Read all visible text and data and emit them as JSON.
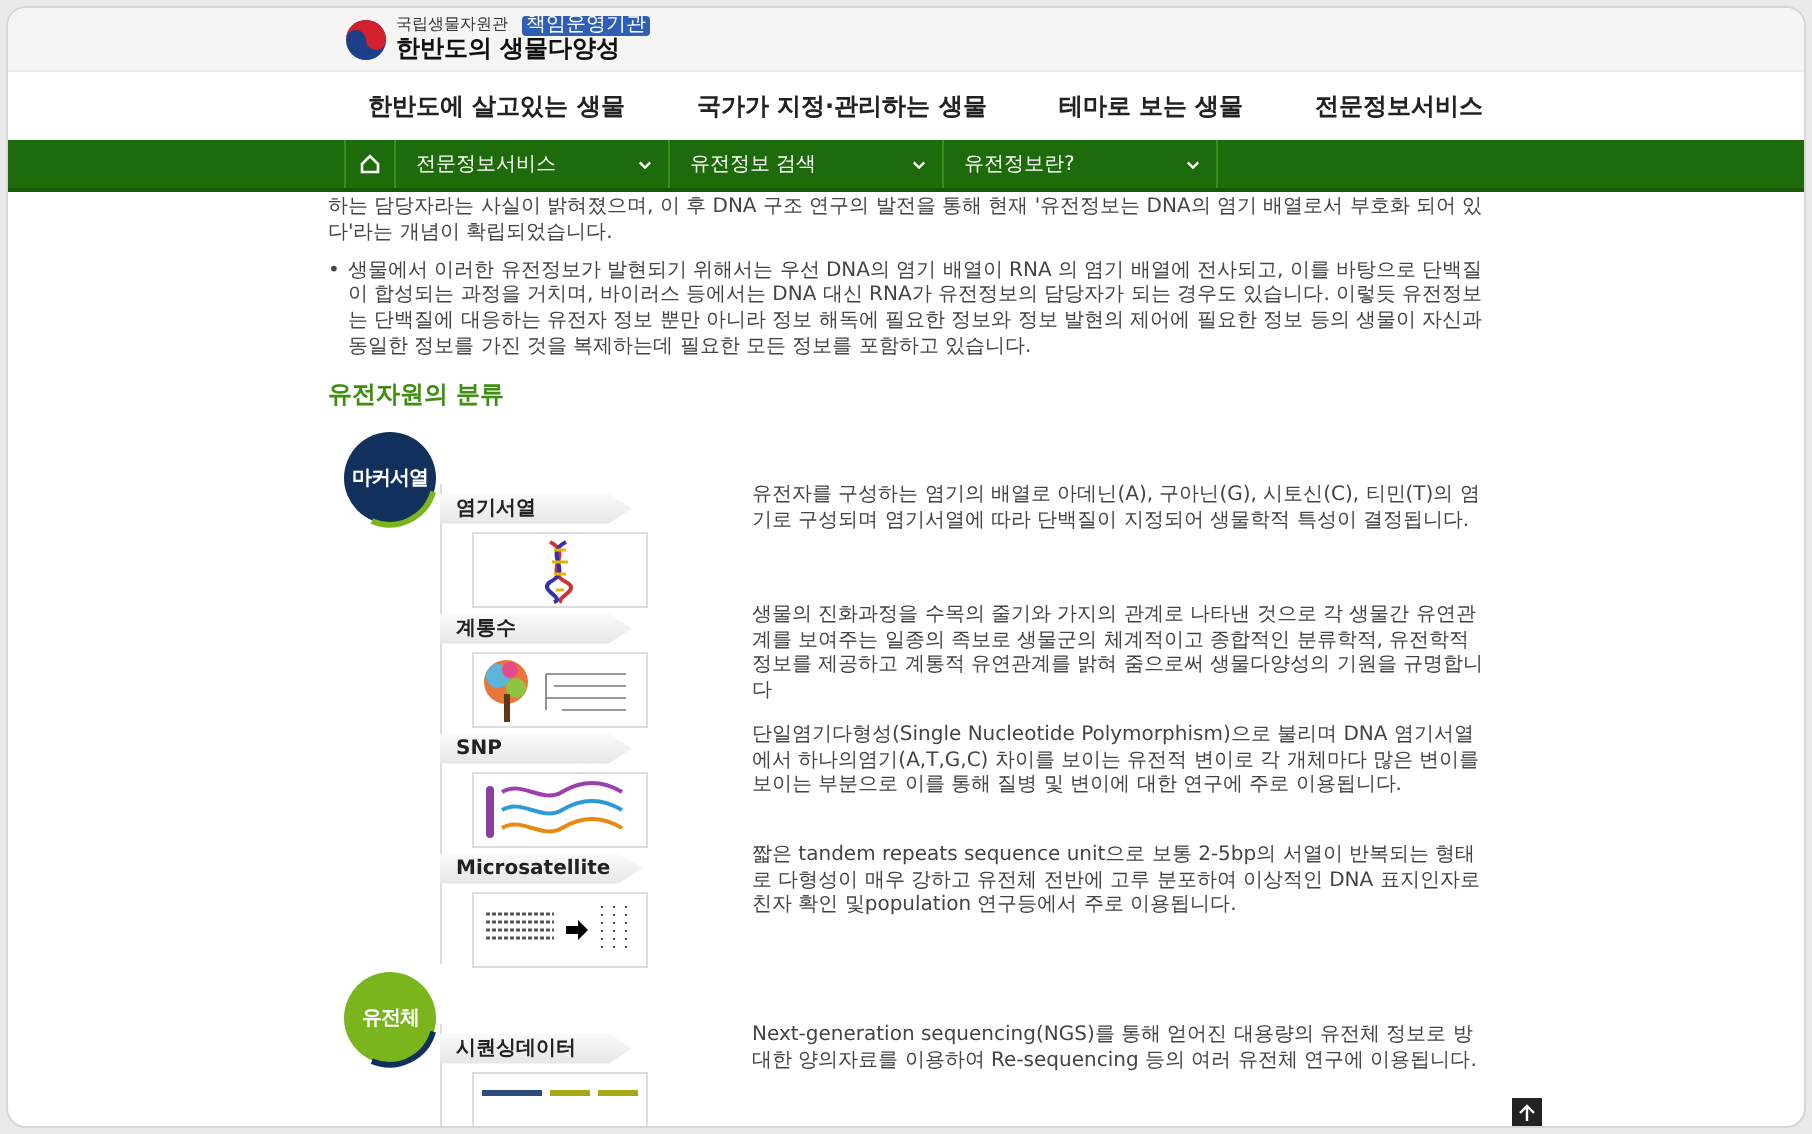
{
  "site": {
    "agency": "국립생물자원관",
    "badge": "책임운영기관",
    "title": "한반도의 생물다양성"
  },
  "nav": [
    "한반도에 살고있는 생물",
    "국가가 지정·관리하는 생물",
    "테마로 보는 생물",
    "전문정보서비스"
  ],
  "breadcrumb": [
    "전문정보서비스",
    "유전정보 검색",
    "유전정보란?"
  ],
  "intro": {
    "text": "하는 담당자라는 사실이 밝혀졌으며, 이 후 DNA 구조 연구의 발전을 통해 현재 '유전정보는 DNA의 염기 배열로서 부호화 되어 있다'라는 개념이 확립되었습니다.",
    "bullets": [
      {
        "marker": "•",
        "text": "생물에서 이러한 유전정보가 발현되기 위해서는 우선 DNA의 염기 배열이 RNA 의 염기 배열에 전사되고, 이를 바탕으로 단백질이 합성되는 과정을 거치며, 바이러스 등에서는 DNA 대신 RNA가 유전정보의 담당자가 되는 경우도 있습니다. 이렇듯 유전정보는 단백질에 대응하는 유전자 정보 뿐만 아니라 정보 해독에 필요한 정보와 정보 발현의 제어에 필요한 정보 등의 생물이 자신과 동일한 정보를 가진 것을 복제하는데 필요한 모든 정보를 포함하고 있습니다."
      }
    ]
  },
  "section_title": "유전자원의 분류",
  "categories": [
    {
      "label": "마커서열",
      "color": "#12305c",
      "items": [
        {
          "label": "염기서열",
          "kind": "dna",
          "description": "유전자를 구성하는 염기의 배열로 아데닌(A), 구아닌(G), 시토신(C), 티민(T)의 염기로 구성되며 염기서열에 따라 단백질이 지정되어 생물학적 특성이 결정됩니다."
        },
        {
          "label": "계통수",
          "kind": "tree",
          "description": "생물의 진화과정을 수목의 줄기와 가지의 관계로 나타낸 것으로 각 생물간 유연관계를 보여주는 일종의 족보로 생물군의 체계적이고 종합적인 분류학적, 유전학적 정보를 제공하고 계통적 유연관계를 밝혀 줌으로써 생물다양성의 기원을 규명합니다"
        },
        {
          "label": "SNP",
          "kind": "snp",
          "description": "단일염기다형성(Single Nucleotide Polymorphism)으로 불리며 DNA 염기서열에서 하나의염기(A,T,G,C) 차이를 보이는 유전적 변이로 각 개체마다 많은 변이를 보이는 부분으로 이를 통해 질병 및 변이에 대한 연구에 주로 이용됩니다."
        },
        {
          "label": "Microsatellite",
          "kind": "repeats",
          "description": "짧은 tandem repeats sequence unit으로 보통 2-5bp의 서열이 반복되는 형태로 다형성이 매우 강하고 유전체 전반에 고루 분포하여 이상적인 DNA 표지인자로 친자 확인 및population 연구등에서 주로 이용됩니다."
        }
      ]
    },
    {
      "label": "유전체",
      "color": "#7ab51d",
      "items": [
        {
          "label": "시퀀싱데이터",
          "kind": "bars",
          "description": "Next-generation sequencing(NGS)를 통해 얻어진 대용량의 유전체 정보로 방대한 양의자료를 이용하여 Re-sequencing 등의 여러 유전체 연구에 이용됩니다."
        }
      ]
    }
  ]
}
